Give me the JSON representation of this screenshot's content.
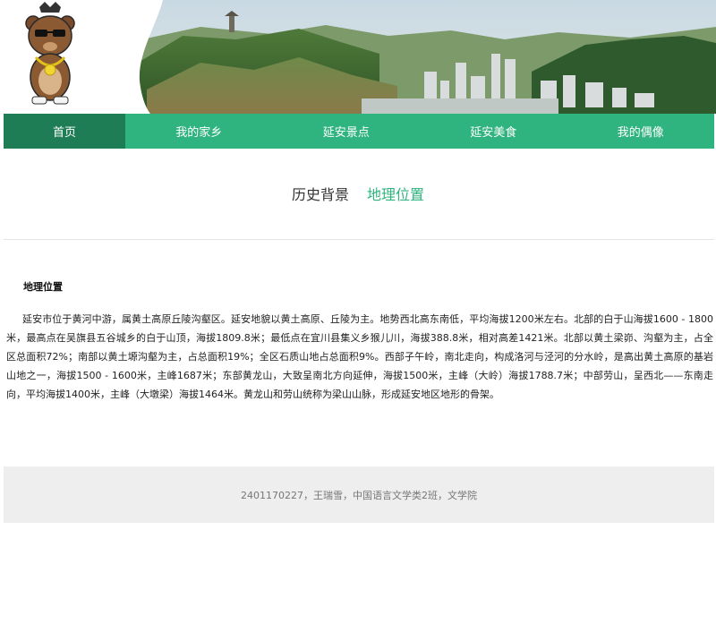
{
  "nav": {
    "items": [
      {
        "label": "首页"
      },
      {
        "label": "我的家乡"
      },
      {
        "label": "延安景点"
      },
      {
        "label": "延安美食"
      },
      {
        "label": "我的偶像"
      }
    ]
  },
  "subtabs": {
    "history": "历史背景",
    "geography": "地理位置"
  },
  "section": {
    "title": "地理位置",
    "body": "延安市位于黄河中游，属黄土高原丘陵沟壑区。延安地貌以黄土高原、丘陵为主。地势西北高东南低，平均海拔1200米左右。北部的白于山海拔1600 - 1800米，最高点在吴旗县五谷城乡的白于山顶，海拔1809.8米；最低点在宜川县集义乡猴儿川，海拔388.8米，相对高差1421米。北部以黄土梁峁、沟壑为主，占全区总面积72%；南部以黄土塬沟壑为主，占总面积19%；全区石质山地占总面积9%。西部子午岭，南北走向，构成洛河与泾河的分水岭，是高出黄土高原的基岩山地之一，海拔1500 - 1600米，主峰1687米；东部黄龙山，大致呈南北方向延伸，海拔1500米，主峰（大岭）海拔1788.7米；中部劳山，呈西北——东南走向，平均海拔1400米，主峰（大墩梁）海拔1464米。黄龙山和劳山统称为梁山山脉，形成延安地区地形的骨架。"
  },
  "footer": {
    "text": "2401170227，王瑞雪，中国语言文学类2班，文学院"
  },
  "colors": {
    "nav": "#2fb37f",
    "nav_active": "#1f7d55",
    "accent": "#2fb37f",
    "footer_bg": "#eeeeee"
  }
}
